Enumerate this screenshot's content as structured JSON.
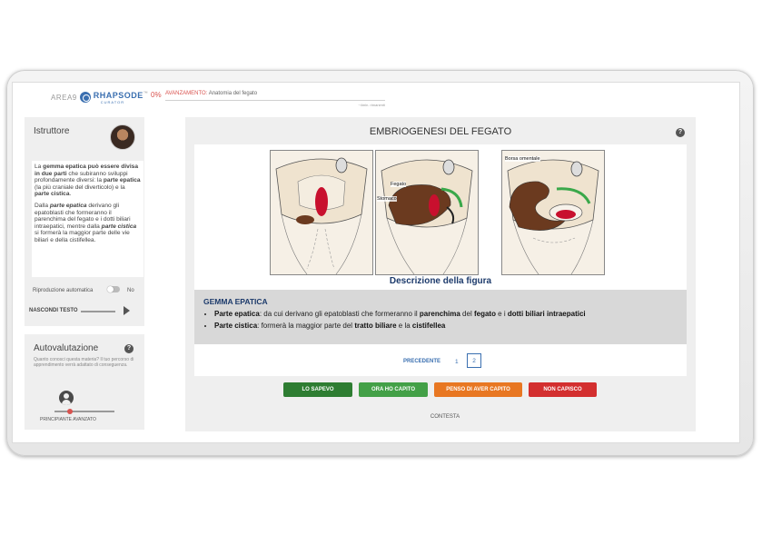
{
  "header": {
    "logo_area": "AREA9",
    "logo_brand": "RHAPSODE",
    "logo_tm": "™",
    "logo_sub": "CURATOR",
    "progress_percent": "0%",
    "progress_fraction": 0,
    "progress_label": "AVANZAMENTO:",
    "progress_topic": "Anatomia del fegato",
    "time_remaining": "~4min. rimanenti"
  },
  "instructor": {
    "title": "Istruttore",
    "text_html": "<p>La <b>gemma epatica può essere divisa in due parti</b> che subiranno sviluppi profondamente diversi: la <b>parte epatica</b> (la più craniale del diverticolo) e la <b>parte cistica</b>.</p><p>Dalla <b><i>parte epatica</i></b> derivano gli epatoblasti che formeranno il parenchima del fegato e i dotti biliari intraepatici, mentre dalla <b><i>parte cistica</i></b> si formerà la maggior parte delle vie biliari e della cistifellea.</p>",
    "autoplay_label": "Riproduzione automatica",
    "autoplay_value": "No",
    "hide_text_label": "NASCONDI TESTO"
  },
  "self_evaluation": {
    "title": "Autovalutazione",
    "description": "Quanto conosci questa materia? Il tuo percorso di apprendimento verrà adattato di conseguenza.",
    "level_fraction": 0.25,
    "range_labels": "PRINCIPIANTE AVANZATO"
  },
  "lesson": {
    "title": "EMBRIOGENESI DEL FEGATO",
    "figure_labels": {
      "fegato": "Fegato",
      "stomaco": "Stomaco",
      "borsa": "Borsa omentale"
    },
    "caption": "Descrizione della figura",
    "description_heading": "GEMMA EPATICA",
    "bullets_html": [
      "<b>Parte epatica</b>: da cui derivano gli epatoblasti che formeranno il <b>parenchima</b> del <b>fegato</b> e i <b>dotti biliari intraepatici</b>",
      "<b>Parte cistica</b>: formerà la maggior parte del <b>tratto biliare</b> e la <b>cistifellea</b>"
    ],
    "pager": {
      "prev": "PRECEDENTE",
      "page1": "1",
      "page2": "2"
    }
  },
  "actions": {
    "b1": "LO SAPEVO",
    "b2": "ORA HO CAPITO",
    "b3": "PENSO DI AVER CAPITO",
    "b4": "NON CAPISCO",
    "contest": "CONTESTA"
  },
  "colors": {
    "accent": "#d9534f",
    "brand": "#3a6fb0",
    "green_dark": "#2e7d32",
    "green": "#43a047",
    "orange": "#e87722",
    "red": "#d32f2f"
  }
}
